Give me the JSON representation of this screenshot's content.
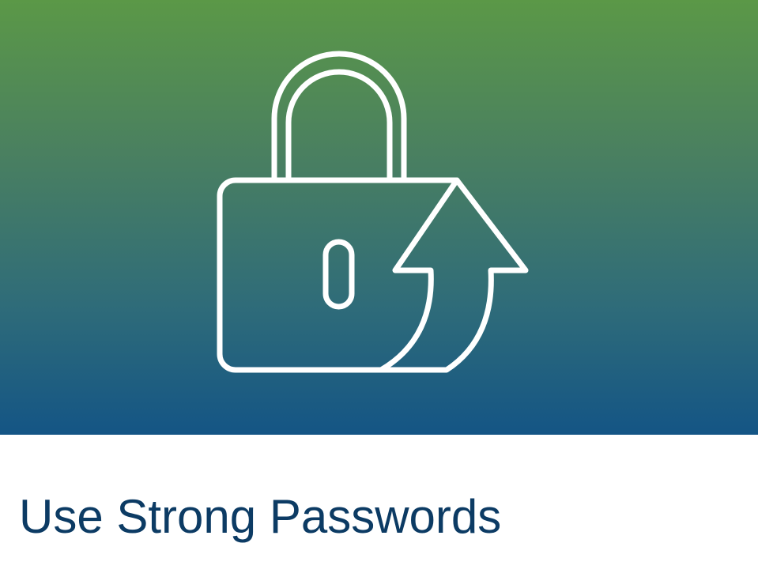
{
  "card": {
    "title": "Use Strong Passwords",
    "icon": "lock-upgrade-icon",
    "colors": {
      "gradient_top": "#5b9847",
      "gradient_bottom": "#145585",
      "title_text": "#0c3b64",
      "icon_stroke": "#ffffff",
      "background": "#ffffff"
    }
  }
}
